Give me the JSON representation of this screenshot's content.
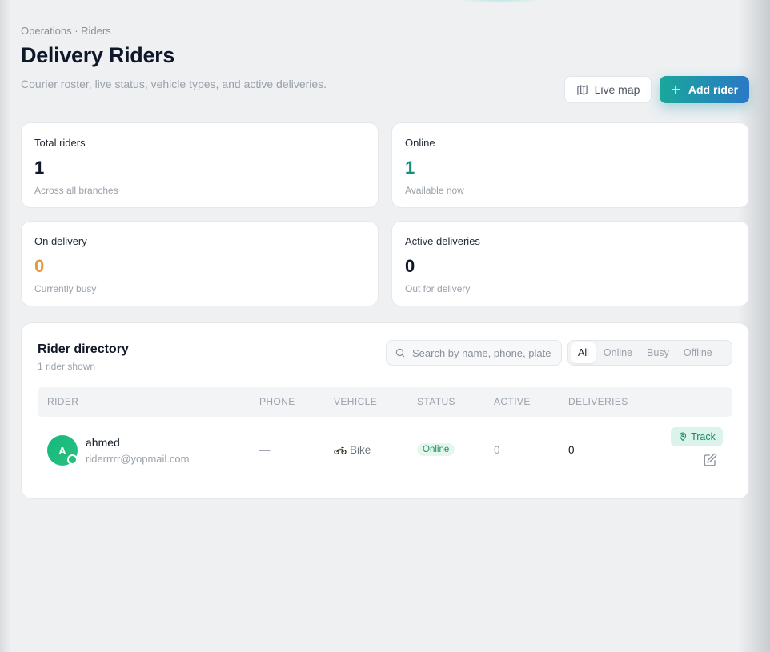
{
  "breadcrumb": "Operations · Riders",
  "page_title": "Delivery Riders",
  "subtitle": "Courier roster, live status, vehicle types, and active deliveries.",
  "actions": {
    "live_map": "Live map",
    "add_rider": "Add rider"
  },
  "stats": [
    {
      "label": "Total riders",
      "value": "1",
      "note": "Across all branches",
      "color": "#0f172a"
    },
    {
      "label": "Online",
      "value": "1",
      "note": "Available now",
      "color": "#14907a"
    },
    {
      "label": "On delivery",
      "value": "0",
      "note": "Currently busy",
      "color": "#e39a3b"
    },
    {
      "label": "Active deliveries",
      "value": "0",
      "note": "Out for delivery",
      "color": "#0f172a"
    }
  ],
  "directory": {
    "title": "Rider directory",
    "count": "1 rider shown",
    "search_placeholder": "Search by name, phone, plate",
    "filters": [
      "All",
      "Online",
      "Busy",
      "Offline"
    ],
    "active_filter": "All",
    "columns": [
      "RIDER",
      "PHONE",
      "VEHICLE",
      "STATUS",
      "ACTIVE",
      "DELIVERIES"
    ],
    "rows": [
      {
        "initial": "A",
        "name": "ahmed",
        "email": "riderrrrr@yopmail.com",
        "phone": "—",
        "vehicle": "Bike",
        "vehicle_icon": "motorcycle-icon",
        "status": "Online",
        "active": "0",
        "deliveries": "0",
        "track_label": "Track"
      }
    ]
  }
}
